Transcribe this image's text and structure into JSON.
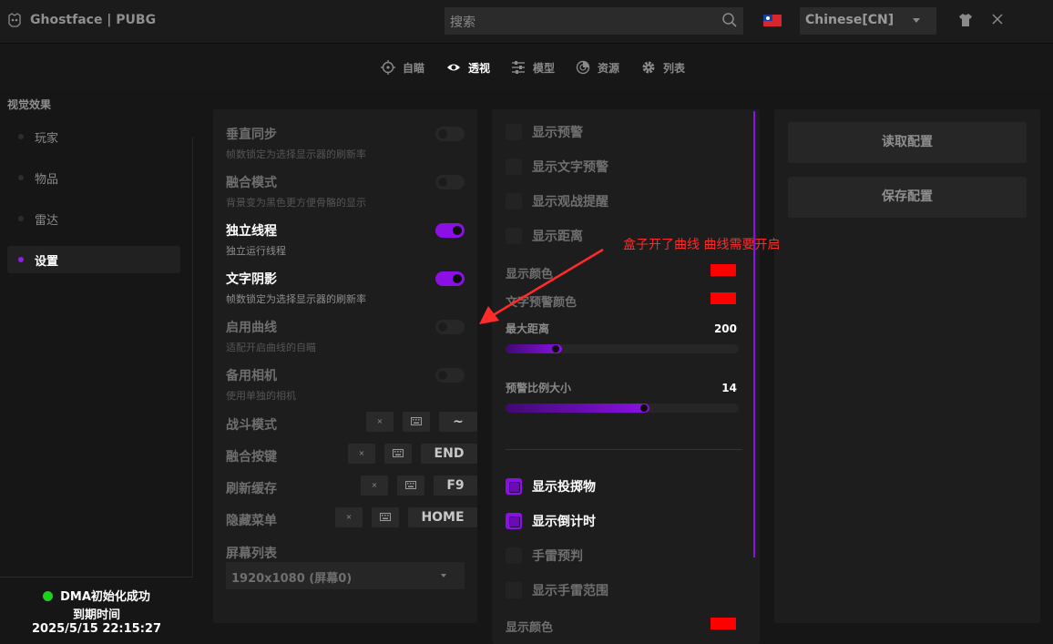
{
  "app": {
    "title": "Ghostface | PUBG",
    "search_placeholder": "搜索",
    "language": "Chinese[CN]"
  },
  "tabs": [
    {
      "label": "自瞄",
      "icon": "crosshair-icon",
      "active": false
    },
    {
      "label": "透视",
      "icon": "eye-icon",
      "active": true
    },
    {
      "label": "模型",
      "icon": "sliders-icon",
      "active": false
    },
    {
      "label": "资源",
      "icon": "radar-icon",
      "active": false
    },
    {
      "label": "列表",
      "icon": "gear-icon",
      "active": false
    }
  ],
  "sidebar": {
    "title": "视觉效果",
    "items": [
      {
        "label": "玩家",
        "active": false
      },
      {
        "label": "物品",
        "active": false
      },
      {
        "label": "雷达",
        "active": false
      },
      {
        "label": "设置",
        "active": true
      }
    ]
  },
  "status": {
    "text": "DMA初始化成功",
    "expiry_label": "到期时间",
    "expiry_value": "2025/5/15 22:15:27",
    "color": "#19d21b"
  },
  "settings": {
    "toggles": [
      {
        "title": "垂直同步",
        "desc": "帧数锁定为选择显示器的刷新率",
        "on": false
      },
      {
        "title": "融合模式",
        "desc": "背景变为黑色更方便骨骼的显示",
        "on": false
      },
      {
        "title": "独立线程",
        "desc": "独立运行线程",
        "on": true
      },
      {
        "title": "文字阴影",
        "desc": "帧数锁定为选择显示器的刷新率",
        "on": true
      },
      {
        "title": "启用曲线",
        "desc": "适配开启曲线的自瞄",
        "on": false
      },
      {
        "title": "备用相机",
        "desc": "使用单独的相机",
        "on": false
      }
    ],
    "keybinds": [
      {
        "label": "战斗模式",
        "clear": "×",
        "key": "~"
      },
      {
        "label": "融合按键",
        "clear": "×",
        "key": "END"
      },
      {
        "label": "刷新缓存",
        "clear": "×",
        "key": "F9"
      },
      {
        "label": "隐藏菜单",
        "clear": "×",
        "key": "HOME"
      }
    ],
    "screen_list_label": "屏幕列表",
    "screen_list_value": "1920x1080 (屏幕0)"
  },
  "warnings": {
    "checks_top": [
      {
        "label": "显示预警",
        "on": false
      },
      {
        "label": "显示文字预警",
        "on": false
      },
      {
        "label": "显示观战提醒",
        "on": false
      },
      {
        "label": "显示距离",
        "on": false
      }
    ],
    "colors": [
      {
        "label": "显示颜色",
        "color": "#ff0000"
      },
      {
        "label": "文字预警颜色",
        "color": "#ff0000"
      }
    ],
    "sliders": [
      {
        "label": "最大距离",
        "value": "200",
        "fraction": 0.22
      },
      {
        "label": "预警比例大小",
        "value": "14",
        "fraction": 0.6
      }
    ],
    "checks_bottom": [
      {
        "label": "显示投掷物",
        "on": true
      },
      {
        "label": "显示倒计时",
        "on": true
      },
      {
        "label": "手雷预判",
        "on": false
      },
      {
        "label": "显示手雷范围",
        "on": false
      }
    ],
    "partial_label": "显示颜色"
  },
  "config": {
    "load_label": "读取配置",
    "save_label": "保存配置"
  },
  "annotation": {
    "text": "盒子开了曲线 曲线需要开启",
    "color": "#ff2a2a"
  },
  "colors": {
    "accent": "#8b10e6",
    "background": "#161616",
    "panel": "#1d1d1d"
  }
}
